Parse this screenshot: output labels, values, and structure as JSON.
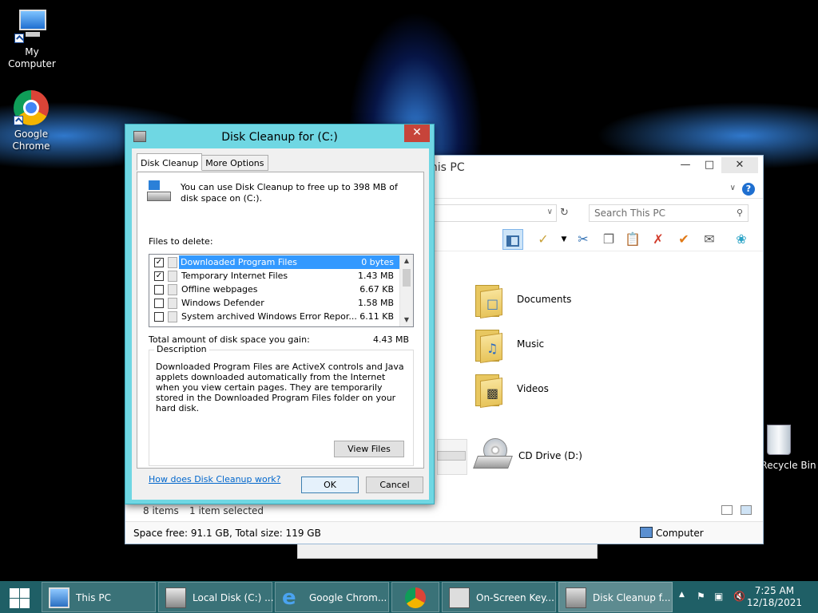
{
  "desktop": {
    "icons": [
      {
        "label": "My Computer"
      },
      {
        "label": "Google Chrome"
      },
      {
        "label": "Recycle Bin"
      }
    ]
  },
  "explorer": {
    "title": "This PC",
    "search_placeholder": "Search This PC",
    "items": [
      {
        "label": "Documents"
      },
      {
        "label": "Music"
      },
      {
        "label": "Videos"
      },
      {
        "label": "CD Drive (D:)"
      }
    ],
    "status_count": "8 items",
    "status_selected": "1 item selected",
    "space_info": "Space free: 91.1 GB, Total size: 119 GB",
    "location": "Computer"
  },
  "dialog": {
    "title": "Disk Cleanup for  (C:)",
    "tabs": [
      "Disk Cleanup",
      "More Options"
    ],
    "intro": "You can use Disk Cleanup to free up to 398 MB of disk space on  (C:).",
    "files_label": "Files to delete:",
    "files": [
      {
        "name": "Downloaded Program Files",
        "size": "0 bytes",
        "checked": true
      },
      {
        "name": "Temporary Internet Files",
        "size": "1.43 MB",
        "checked": true
      },
      {
        "name": "Offline webpages",
        "size": "6.67 KB",
        "checked": false
      },
      {
        "name": "Windows Defender",
        "size": "1.58 MB",
        "checked": false
      },
      {
        "name": "System archived Windows Error Repor...",
        "size": "6.11 KB",
        "checked": false
      }
    ],
    "total_label": "Total amount of disk space you gain:",
    "total_value": "4.43 MB",
    "desc_legend": "Description",
    "description": "Downloaded Program Files are ActiveX controls and Java applets downloaded automatically from the Internet when you view certain pages. They are temporarily stored in the Downloaded Program Files folder on your hard disk.",
    "view_files": "View Files",
    "help_link": "How does Disk Cleanup work?",
    "ok": "OK",
    "cancel": "Cancel"
  },
  "taskbar": {
    "buttons": [
      {
        "label": "This PC"
      },
      {
        "label": "Local Disk (C:) ..."
      },
      {
        "label": "Google Chrom..."
      },
      {
        "label": ""
      },
      {
        "label": "On-Screen Key..."
      },
      {
        "label": "Disk Cleanup f..."
      }
    ],
    "time": "7:25 AM",
    "date": "12/18/2021"
  },
  "colors": {
    "dialog_frame": "#6fd7e3",
    "taskbar": "#1f5f66",
    "selection": "#3399ff",
    "link": "#0066cc"
  }
}
